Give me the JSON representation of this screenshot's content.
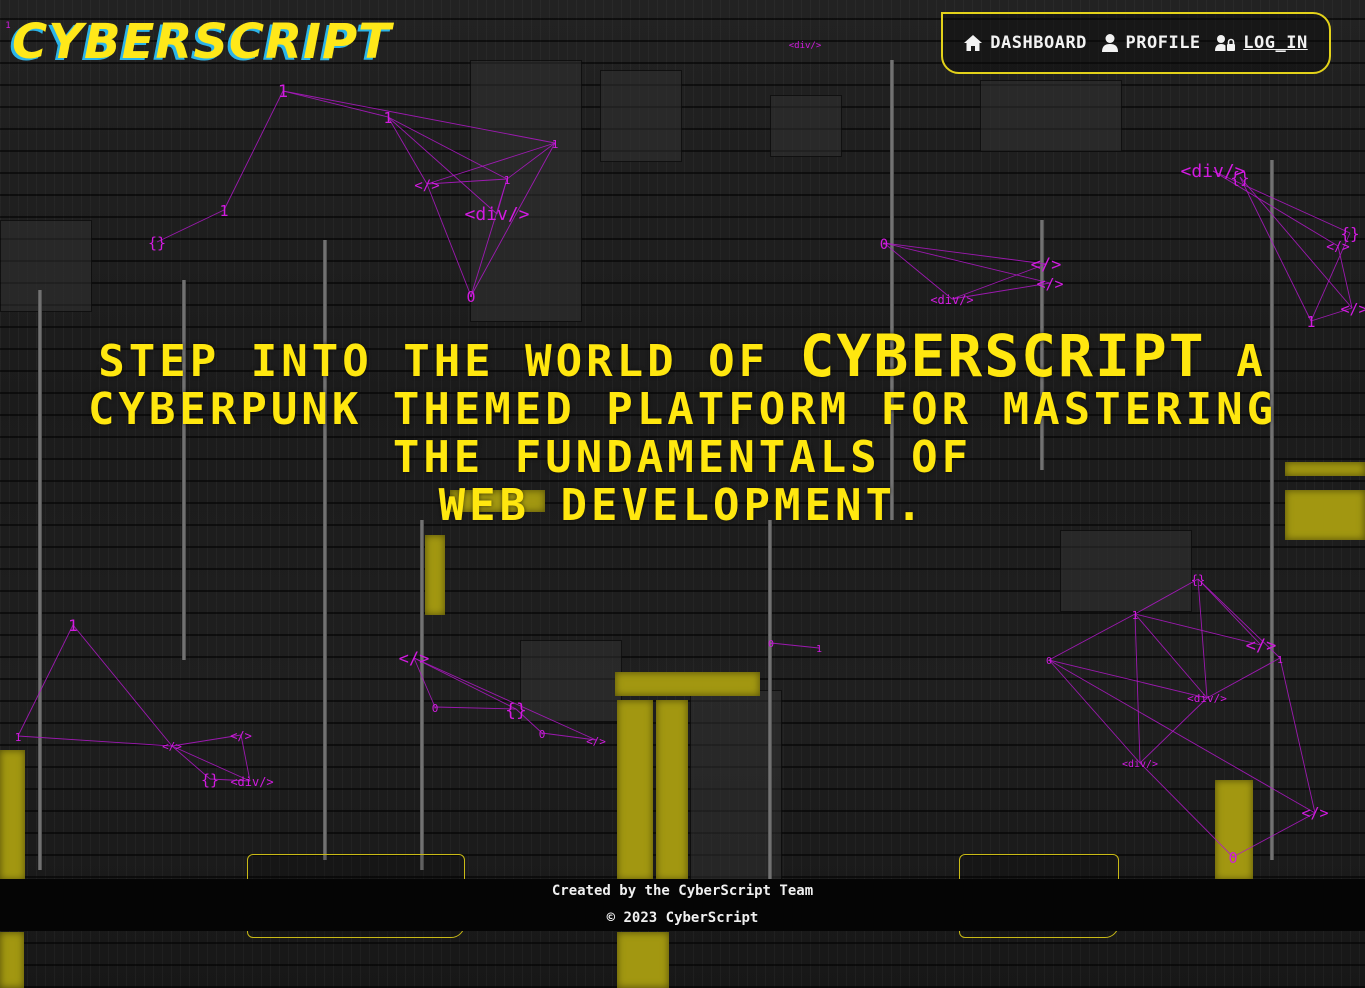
{
  "header": {
    "logo": "CYBERSCRIPT",
    "nav": [
      {
        "label": "DASHBOARD",
        "icon": "home-icon"
      },
      {
        "label": "PROFILE",
        "icon": "user-icon"
      },
      {
        "label": "LOG_IN",
        "icon": "user-lock-icon"
      }
    ]
  },
  "hero": {
    "before": "Step into the world of",
    "brand": "CyberScript",
    "after": "a cyberpunk themed platform for mastering the fundamentals of",
    "end": "web development."
  },
  "footer": {
    "credit": "Created by the CyberScript Team",
    "copyright": "© 2023 CyberScript"
  },
  "network_labels": {
    "one": "1",
    "zero": "0",
    "close_tag": "</>",
    "div_tag": "<div/>",
    "braces": "{}"
  },
  "colors": {
    "accent_yellow": "#ffe70f",
    "logo_shadow_blue": "#2bb4e8",
    "network_magenta": "#d21be0",
    "footer_bg": "#050505"
  }
}
